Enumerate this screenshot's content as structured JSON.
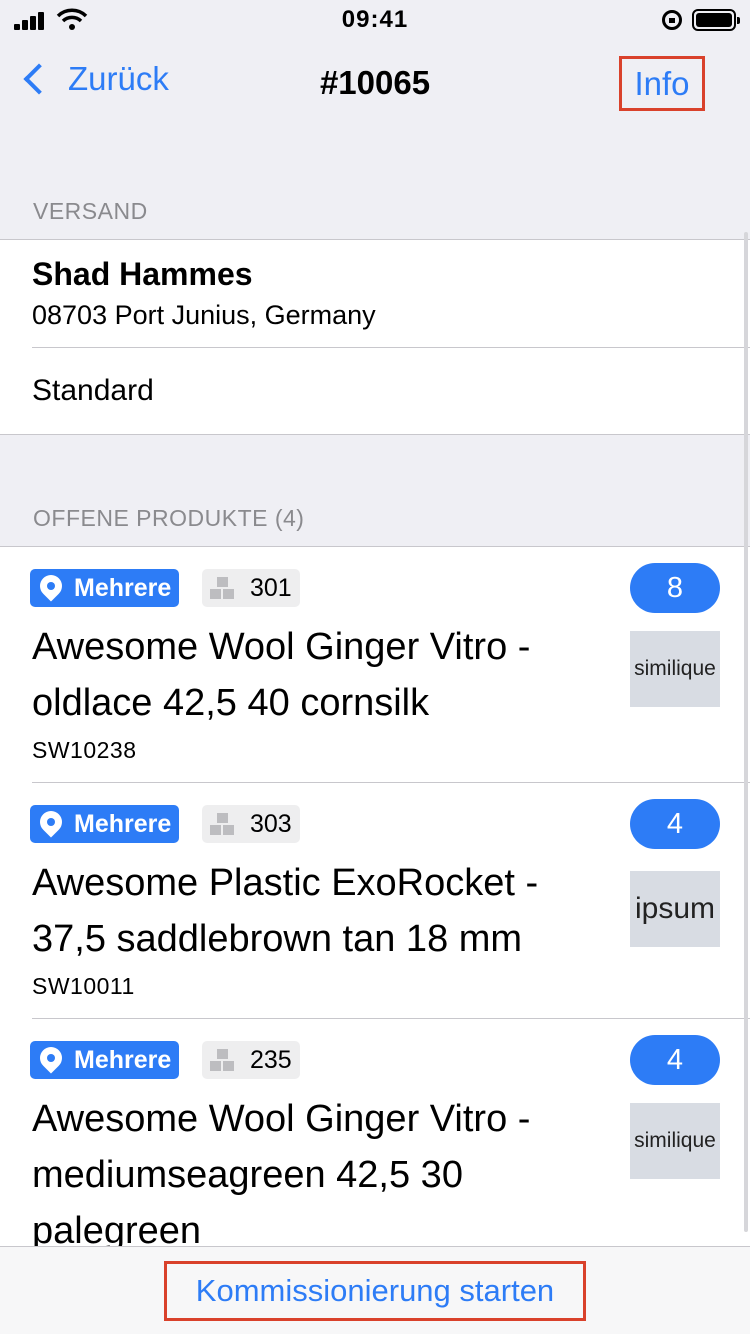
{
  "status": {
    "time": "09:41"
  },
  "nav": {
    "back_label": "Zurück",
    "title": "#10065",
    "info_label": "Info"
  },
  "shipping": {
    "header": "VERSAND",
    "customer_name": "Shad Hammes",
    "address": "08703 Port Junius, Germany",
    "method": "Standard"
  },
  "products_header": "OFFENE PRODUKTE (4)",
  "products": [
    {
      "location": "Mehrere",
      "stock": "301",
      "quantity": "8",
      "image_text": "similique",
      "title": "Awesome Wool Ginger Vitro - oldlace 42,5 40 cornsilk",
      "sku": "SW10238"
    },
    {
      "location": "Mehrere",
      "stock": "303",
      "quantity": "4",
      "image_text": "ipsum",
      "title": "Awesome Plastic ExoRocket - 37,5 saddlebrown tan 18 mm",
      "sku": "SW10011"
    },
    {
      "location": "Mehrere",
      "stock": "235",
      "quantity": "4",
      "image_text": "similique",
      "title": "Awesome Wool Ginger Vitro - mediumseagreen 42,5 30 palegreen",
      "sku": ""
    }
  ],
  "toolbar": {
    "start_label": "Kommissionierung starten"
  },
  "colors": {
    "accent": "#2d7cf6",
    "highlight_border": "#d9412b",
    "background": "#efeff4"
  }
}
